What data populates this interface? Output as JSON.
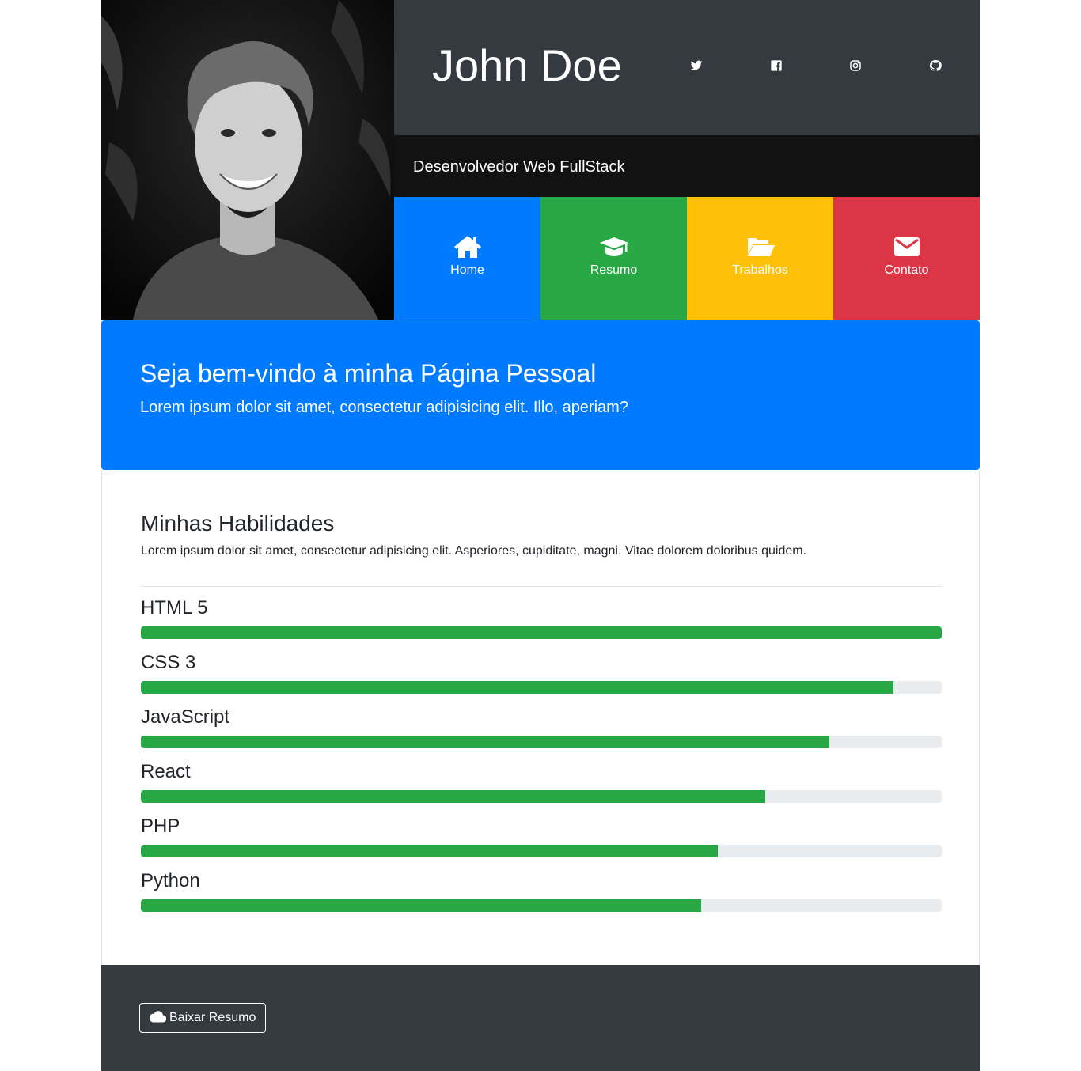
{
  "header": {
    "name": "John Doe",
    "subtitle": "Desenvolvedor Web FullStack",
    "social": [
      {
        "icon": "twitter-icon"
      },
      {
        "icon": "facebook-icon"
      },
      {
        "icon": "instagram-icon"
      },
      {
        "icon": "github-icon"
      }
    ]
  },
  "nav": {
    "home": {
      "label": "Home",
      "icon": "home-icon",
      "color": "#007bff"
    },
    "resumo": {
      "label": "Resumo",
      "icon": "graduation-cap-icon",
      "color": "#28a745"
    },
    "trabalhos": {
      "label": "Trabalhos",
      "icon": "folder-open-icon",
      "color": "#ffc107"
    },
    "contato": {
      "label": "Contato",
      "icon": "envelope-icon",
      "color": "#dc3545"
    }
  },
  "welcome": {
    "title": "Seja bem-vindo à minha Página Pessoal",
    "text": "Lorem ipsum dolor sit amet, consectetur adipisicing elit. Illo, aperiam?"
  },
  "skills": {
    "title": "Minhas Habilidades",
    "description": "Lorem ipsum dolor sit amet, consectetur adipisicing elit. Asperiores, cupiditate, magni. Vitae dolorem doloribus quidem.",
    "items": [
      {
        "name": "HTML 5",
        "percent": 100
      },
      {
        "name": "CSS 3",
        "percent": 94
      },
      {
        "name": "JavaScript",
        "percent": 86
      },
      {
        "name": "React",
        "percent": 78
      },
      {
        "name": "PHP",
        "percent": 72
      },
      {
        "name": "Python",
        "percent": 70
      }
    ]
  },
  "footer": {
    "download_label": "Baixar Resumo",
    "download_icon": "cloud-icon"
  },
  "colors": {
    "dark": "#343a40",
    "black": "#121212",
    "primary": "#007bff",
    "success": "#28a745",
    "warning": "#ffc107",
    "danger": "#dc3545"
  }
}
